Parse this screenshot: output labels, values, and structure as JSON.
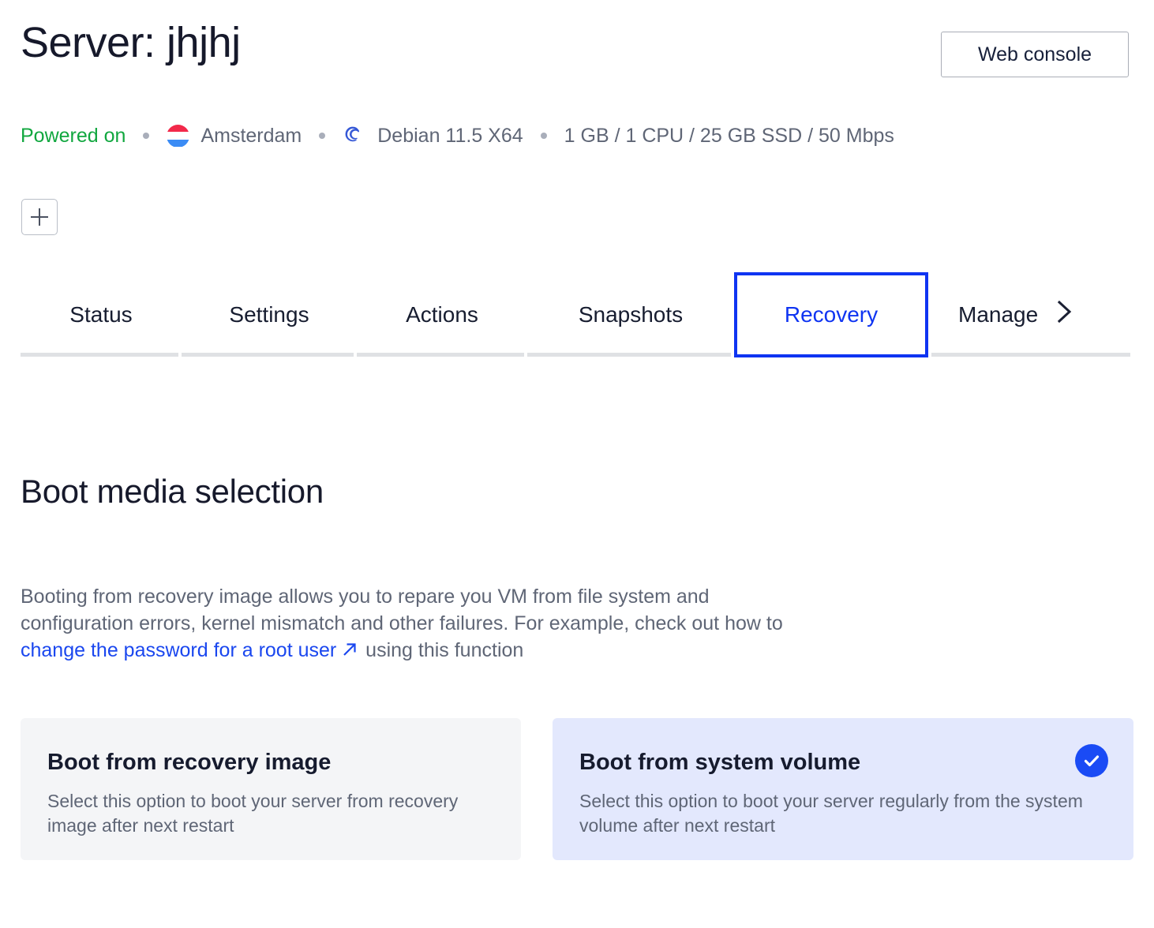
{
  "header": {
    "title": "Server: jhjhj",
    "web_console_label": "Web console"
  },
  "meta": {
    "power_state": "Powered on",
    "region": "Amsterdam",
    "region_flag_icon": "netherlands-flag-icon",
    "os": "Debian 11.5 X64",
    "os_icon": "debian-icon",
    "specs": "1 GB / 1 CPU / 25 GB SSD / 50 Mbps"
  },
  "toolbar": {
    "add_label": "+",
    "add_icon": "plus-icon"
  },
  "tabs": {
    "items": [
      {
        "label": "Status"
      },
      {
        "label": "Settings"
      },
      {
        "label": "Actions"
      },
      {
        "label": "Snapshots"
      },
      {
        "label": "Recovery"
      },
      {
        "label": "Manage"
      }
    ],
    "active": "Recovery",
    "chevron_icon": "chevron-right-icon"
  },
  "main": {
    "section_title": "Boot media selection",
    "description": {
      "part1": "Booting from recovery image allows you to repare you VM from file system and configuration errors, kernel mismatch and other failures. For example, check out how to ",
      "link_text": "change the password for a root user",
      "link_icon": "external-link-arrow-icon",
      "part2": " using this function"
    },
    "options": [
      {
        "title": "Boot from recovery image",
        "description": "Select this option to boot your server from recovery image after next restart",
        "selected": false
      },
      {
        "title": "Boot from system volume",
        "description": "Select this option to boot your server regularly from the system volume after next restart",
        "selected": true,
        "check_icon": "check-circle-icon"
      }
    ]
  },
  "colors": {
    "accent_blue": "#0f34f2",
    "link_blue": "#1a47ef",
    "status_green": "#11a73f",
    "card_selected_bg": "#e3e8fd",
    "card_bg": "#f4f5f7",
    "check_badge": "#1a4bf5"
  }
}
